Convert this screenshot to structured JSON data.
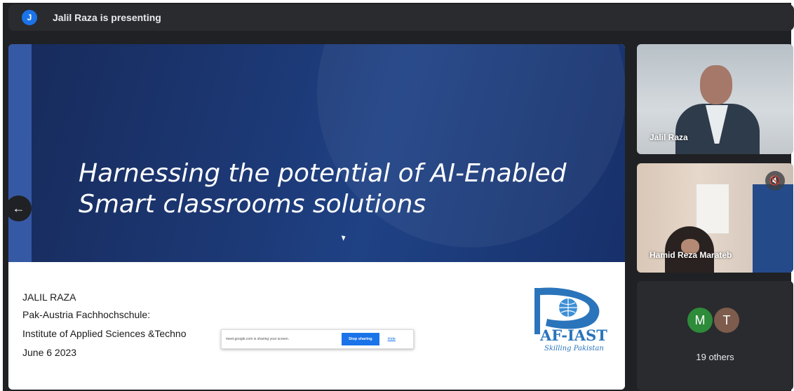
{
  "header": {
    "avatar_initial": "J",
    "presenting_text": "Jalil Raza is presenting"
  },
  "slide": {
    "title_line1": "Harnessing the potential of AI-Enabled",
    "title_line2": "Smart classrooms solutions",
    "presenter_name": "JALIL RAZA",
    "org_line1": "Pak-Austria Fachhochschule:",
    "org_line2": "Institute of Applied Sciences &Techno",
    "date": "June 6 2023",
    "logo_text": "AF-IAST",
    "logo_sub": "Skilling Pakistan"
  },
  "share_banner": {
    "text": "meet.google.com is sharing your screen.",
    "stop_label": "Stop sharing",
    "hide_label": "Hide"
  },
  "participants": {
    "tile1_name": "Jalil Raza",
    "tile2_name": "Hamid Reza Marateb",
    "avatar1": "M",
    "avatar2": "T",
    "others_label": "19 others"
  },
  "icons": {
    "back": "arrow-left-icon",
    "mic": "mic-off-icon"
  },
  "colors": {
    "accent": "#1a73e8",
    "slide_blue": "#1d3a78",
    "logo_blue": "#2a74bb"
  }
}
